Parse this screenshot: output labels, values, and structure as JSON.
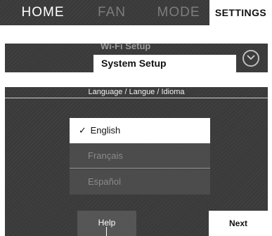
{
  "nav": {
    "home": "HOME",
    "fan": "FAN",
    "mode": "MODE",
    "settings": "SETTINGS",
    "selected": "SETTINGS"
  },
  "menu": {
    "previous_item": "Wi-Fi Setup",
    "selected_item": "System Setup",
    "expand_icon": "chevron-down-circle-icon"
  },
  "language_screen": {
    "title": "Language / Langue / Idioma",
    "options": [
      {
        "label": "English",
        "selected": true,
        "check_icon": "✓"
      },
      {
        "label": "Français",
        "selected": false
      },
      {
        "label": "Español",
        "selected": false
      }
    ],
    "help_button": "Help",
    "next_button": "Next"
  },
  "colors": {
    "panel": "#3a3a3a",
    "selected_bg": "#ffffff",
    "inactive_text": "#7d7d7d"
  }
}
